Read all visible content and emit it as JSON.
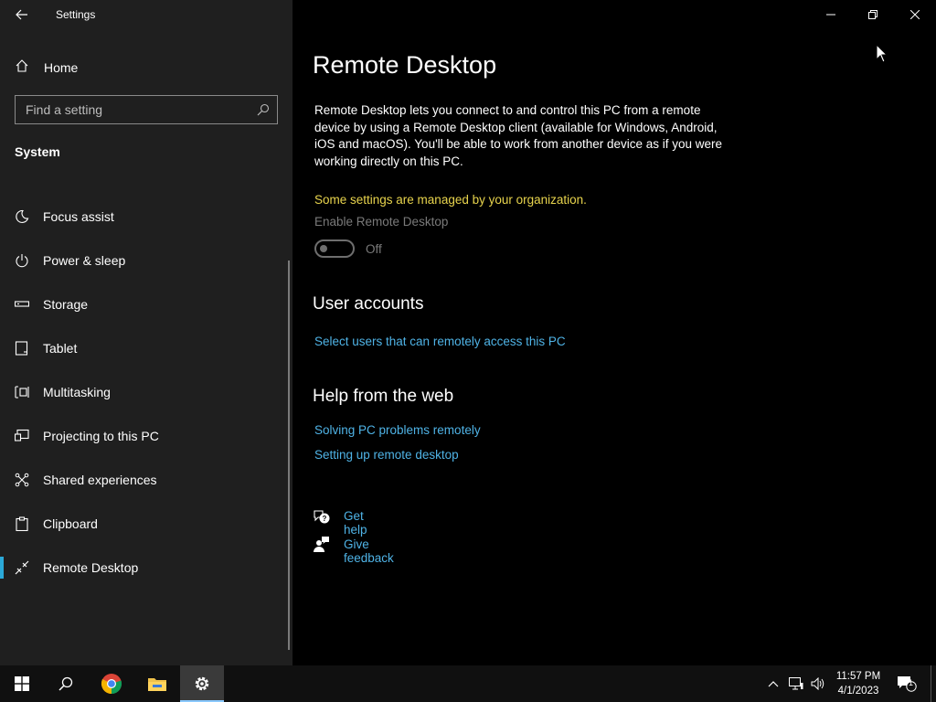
{
  "window": {
    "title": "Settings"
  },
  "sidebar": {
    "home_label": "Home",
    "search_placeholder": "Find a setting",
    "section": "System",
    "items": [
      {
        "label": "Focus assist",
        "icon": "moon-icon"
      },
      {
        "label": "Power & sleep",
        "icon": "power-icon"
      },
      {
        "label": "Storage",
        "icon": "storage-icon"
      },
      {
        "label": "Tablet",
        "icon": "tablet-icon"
      },
      {
        "label": "Multitasking",
        "icon": "multitasking-icon"
      },
      {
        "label": "Projecting to this PC",
        "icon": "projecting-icon"
      },
      {
        "label": "Shared experiences",
        "icon": "shared-experiences-icon"
      },
      {
        "label": "Clipboard",
        "icon": "clipboard-icon"
      },
      {
        "label": "Remote Desktop",
        "icon": "remote-desktop-icon",
        "selected": true
      }
    ]
  },
  "main": {
    "title": "Remote Desktop",
    "description": "Remote Desktop lets you connect to and control this PC from a remote device by using a Remote Desktop client (available for Windows, Android, iOS and macOS). You'll be able to work from another device as if you were working directly on this PC.",
    "managed_notice": "Some settings are managed by your organization.",
    "toggle_label": "Enable Remote Desktop",
    "toggle_state": "Off",
    "toggle_on": false,
    "user_accounts_heading": "User accounts",
    "user_accounts_link": "Select users that can remotely access this PC",
    "help_heading": "Help from the web",
    "help_links": [
      "Solving PC problems remotely",
      "Setting up remote desktop"
    ],
    "get_help": "Get help",
    "give_feedback": "Give feedback"
  },
  "taskbar": {
    "time": "11:57 PM",
    "date": "4/1/2023",
    "notification_count": "1"
  },
  "colors": {
    "accent": "#2ba9d8",
    "link": "#4fb3e6",
    "warning": "#e8d44d"
  }
}
